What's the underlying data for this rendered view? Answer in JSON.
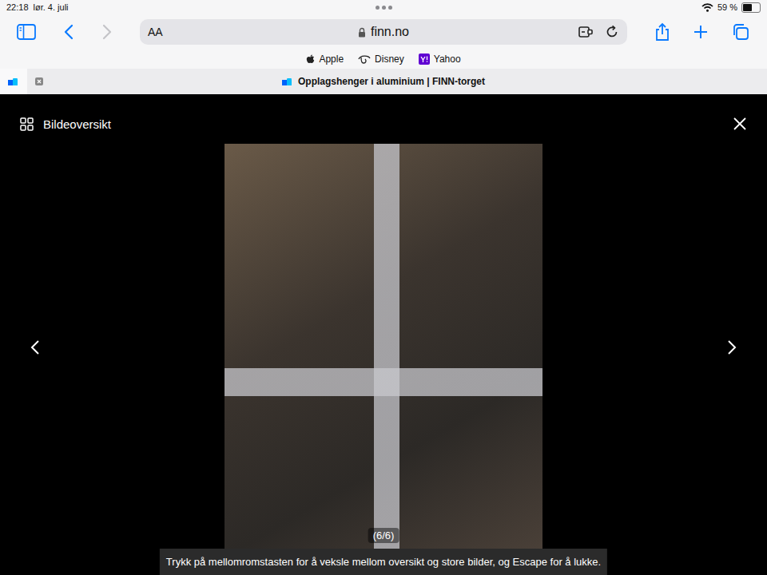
{
  "status_bar": {
    "time": "22:18",
    "date": "lør. 4. juli",
    "battery": "59 %",
    "battery_level": 0.59
  },
  "toolbar": {
    "text_size": "AA",
    "url": "finn.no",
    "back_disabled": false,
    "forward_disabled": true
  },
  "favorites": [
    {
      "label": "Apple"
    },
    {
      "label": "Disney"
    },
    {
      "label": "Yahoo"
    }
  ],
  "tabs": [
    {
      "title": "Opplagshenger i aluminium | FINN-torget",
      "selected": true
    }
  ],
  "viewer": {
    "overview_label": "Bildeoversikt",
    "counter": "(6/6)",
    "hint": "Trykk på mellomromstasten for å veksle mellom oversikt og store bilder, og Escape for å lukke."
  }
}
